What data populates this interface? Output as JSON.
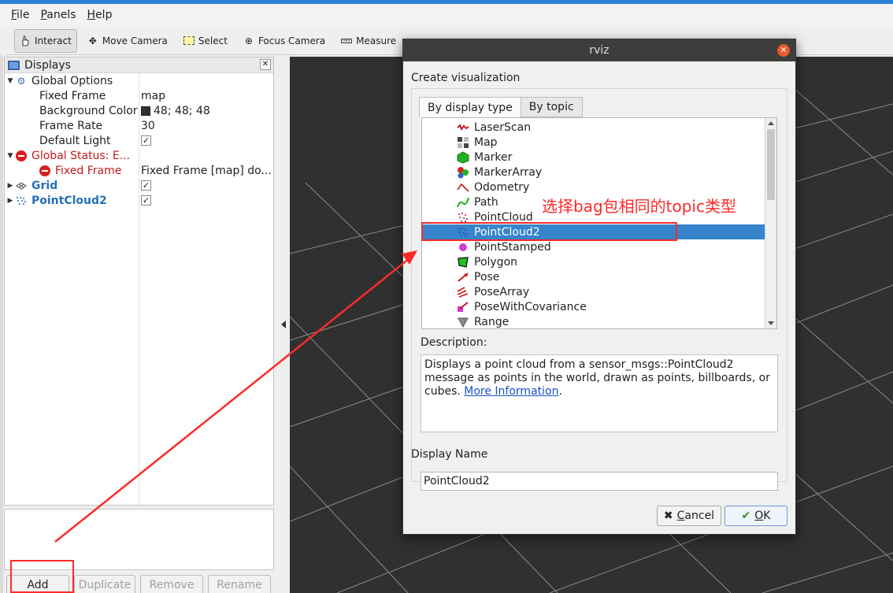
{
  "menubar": {
    "file": "File",
    "panels": "Panels",
    "help": "Help"
  },
  "toolbar": {
    "interact": "Interact",
    "move_camera": "Move Camera",
    "select": "Select",
    "focus_camera": "Focus Camera",
    "measure": "Measure"
  },
  "displays": {
    "title": "Displays",
    "global_options": "Global Options",
    "fixed_frame_label": "Fixed Frame",
    "fixed_frame_value": "map",
    "bg_color_label": "Background Color",
    "bg_color_value": "48; 48; 48",
    "frame_rate_label": "Frame Rate",
    "frame_rate_value": "30",
    "default_light_label": "Default Light",
    "default_light_check": "✓",
    "global_status": "Global Status: E...",
    "status_fixed_frame": "Fixed Frame",
    "status_fixed_frame_value": "Fixed Frame [map] do...",
    "grid": "Grid",
    "grid_check": "✓",
    "pointcloud2": "PointCloud2",
    "pointcloud2_check": "✓"
  },
  "bottom_buttons": {
    "add": "Add",
    "duplicate": "Duplicate",
    "remove": "Remove",
    "rename": "Rename"
  },
  "dialog": {
    "title": "rviz",
    "create_label": "Create visualization",
    "tab_display_type": "By display type",
    "tab_topic": "By topic",
    "items": [
      "LaserScan",
      "Map",
      "Marker",
      "MarkerArray",
      "Odometry",
      "Path",
      "PointCloud",
      "PointCloud2",
      "PointStamped",
      "Polygon",
      "Pose",
      "PoseArray",
      "PoseWithCovariance",
      "Range"
    ],
    "selected_item": "PointCloud2",
    "description_label": "Description:",
    "description_text": "Displays a point cloud from a sensor_msgs::PointCloud2 message as points in the world, drawn as points, billboards, or cubes. ",
    "description_link": "More Information",
    "description_end": ".",
    "display_name_label": "Display Name",
    "display_name_value": "PointCloud2",
    "cancel": "Cancel",
    "ok": "OK"
  },
  "annotation": {
    "text": "选择bag包相同的topic类型",
    "color": "#ff2a2a"
  },
  "colors": {
    "accent": "#3584cc",
    "viewport_bg": "#303030",
    "title_bar": "#3d3d3c",
    "error": "#d62020"
  }
}
